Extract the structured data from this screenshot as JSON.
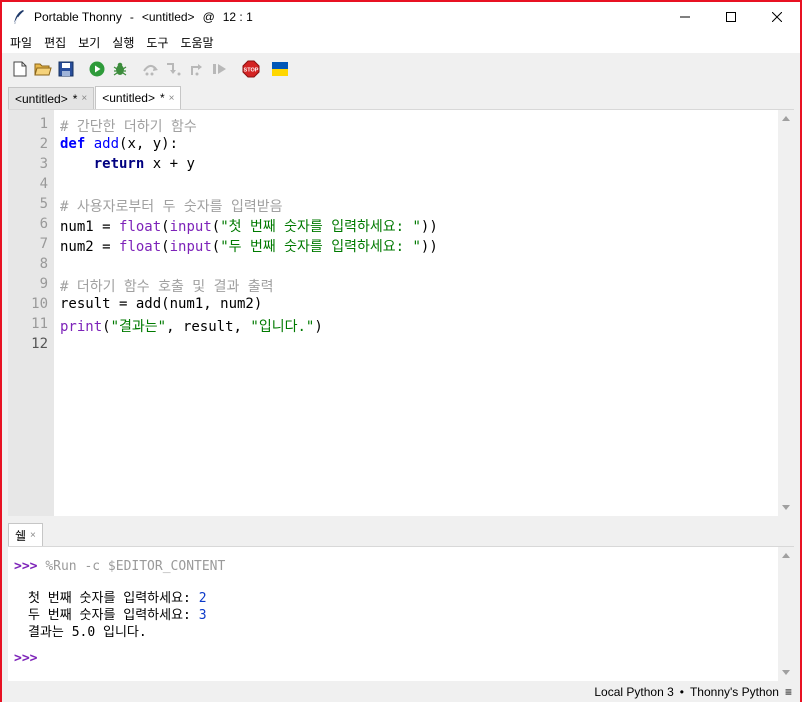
{
  "window": {
    "app_name": "Portable Thonny",
    "separator": "-",
    "doc": "<untitled>",
    "at": "@",
    "cursor_pos": "12 : 1"
  },
  "menu": [
    "파일",
    "편집",
    "보기",
    "실행",
    "도구",
    "도움말"
  ],
  "toolbar": {
    "icons": [
      "new-file-icon",
      "open-file-icon",
      "save-icon",
      "run-icon",
      "debug-icon",
      "step-over-icon",
      "step-into-icon",
      "step-out-icon",
      "resume-icon",
      "stop-icon",
      "ukraine-flag-icon"
    ],
    "stop_text": "STOP"
  },
  "tabs": [
    {
      "label": "<untitled>",
      "modified": "*",
      "close": "×"
    },
    {
      "label": "<untitled>",
      "modified": "*",
      "close": "×"
    }
  ],
  "editor": {
    "line_numbers": [
      "1",
      "2",
      "3",
      "4",
      "5",
      "6",
      "7",
      "8",
      "9",
      "10",
      "11",
      "12"
    ],
    "current_line": "12",
    "tokens": {
      "l1": "# 간단한 더하기 함수",
      "l2_def": "def",
      "l2_name": "add",
      "l2_rest": "(x, y):",
      "l3_indent": "    ",
      "l3_return": "return",
      "l3_rest": " x + y",
      "l5": "# 사용자로부터 두 숫자를 입력받음",
      "l6_a": "num1 = ",
      "l6_float": "float",
      "l6_b": "(",
      "l6_input": "input",
      "l6_c": "(",
      "l6_str": "\"첫 번째 숫자를 입력하세요: \"",
      "l6_d": "))",
      "l7_a": "num2 = ",
      "l7_float": "float",
      "l7_b": "(",
      "l7_input": "input",
      "l7_c": "(",
      "l7_str": "\"두 번째 숫자를 입력하세요: \"",
      "l7_d": "))",
      "l9": "# 더하기 함수 호출 및 결과 출력",
      "l10": "result = add(num1, num2)",
      "l11_print": "print",
      "l11_a": "(",
      "l11_str1": "\"결과는\"",
      "l11_b": ", result, ",
      "l11_str2": "\"입니다.\"",
      "l11_c": ")"
    }
  },
  "shell": {
    "tab_label": "쉘",
    "tab_close": "×",
    "prompt": ">>>",
    "command": "%Run -c $EDITOR_CONTENT",
    "out1_label": "첫 번째 숫자를 입력하세요: ",
    "out1_value": "2",
    "out2_label": "두 번째 숫자를 입력하세요: ",
    "out2_value": "3",
    "out3": "결과는 5.0 입니다."
  },
  "statusbar": {
    "interpreter": "Local Python 3",
    "bullet": "•",
    "python_name": "Thonny's Python",
    "menu_glyph": "≡"
  },
  "colors": {
    "window_border": "#e81123",
    "keyword": "#0000ff",
    "string": "#007a00",
    "comment": "#a0a0a0",
    "builtin": "#7d23b9",
    "shell_input": "#0b39c9"
  }
}
